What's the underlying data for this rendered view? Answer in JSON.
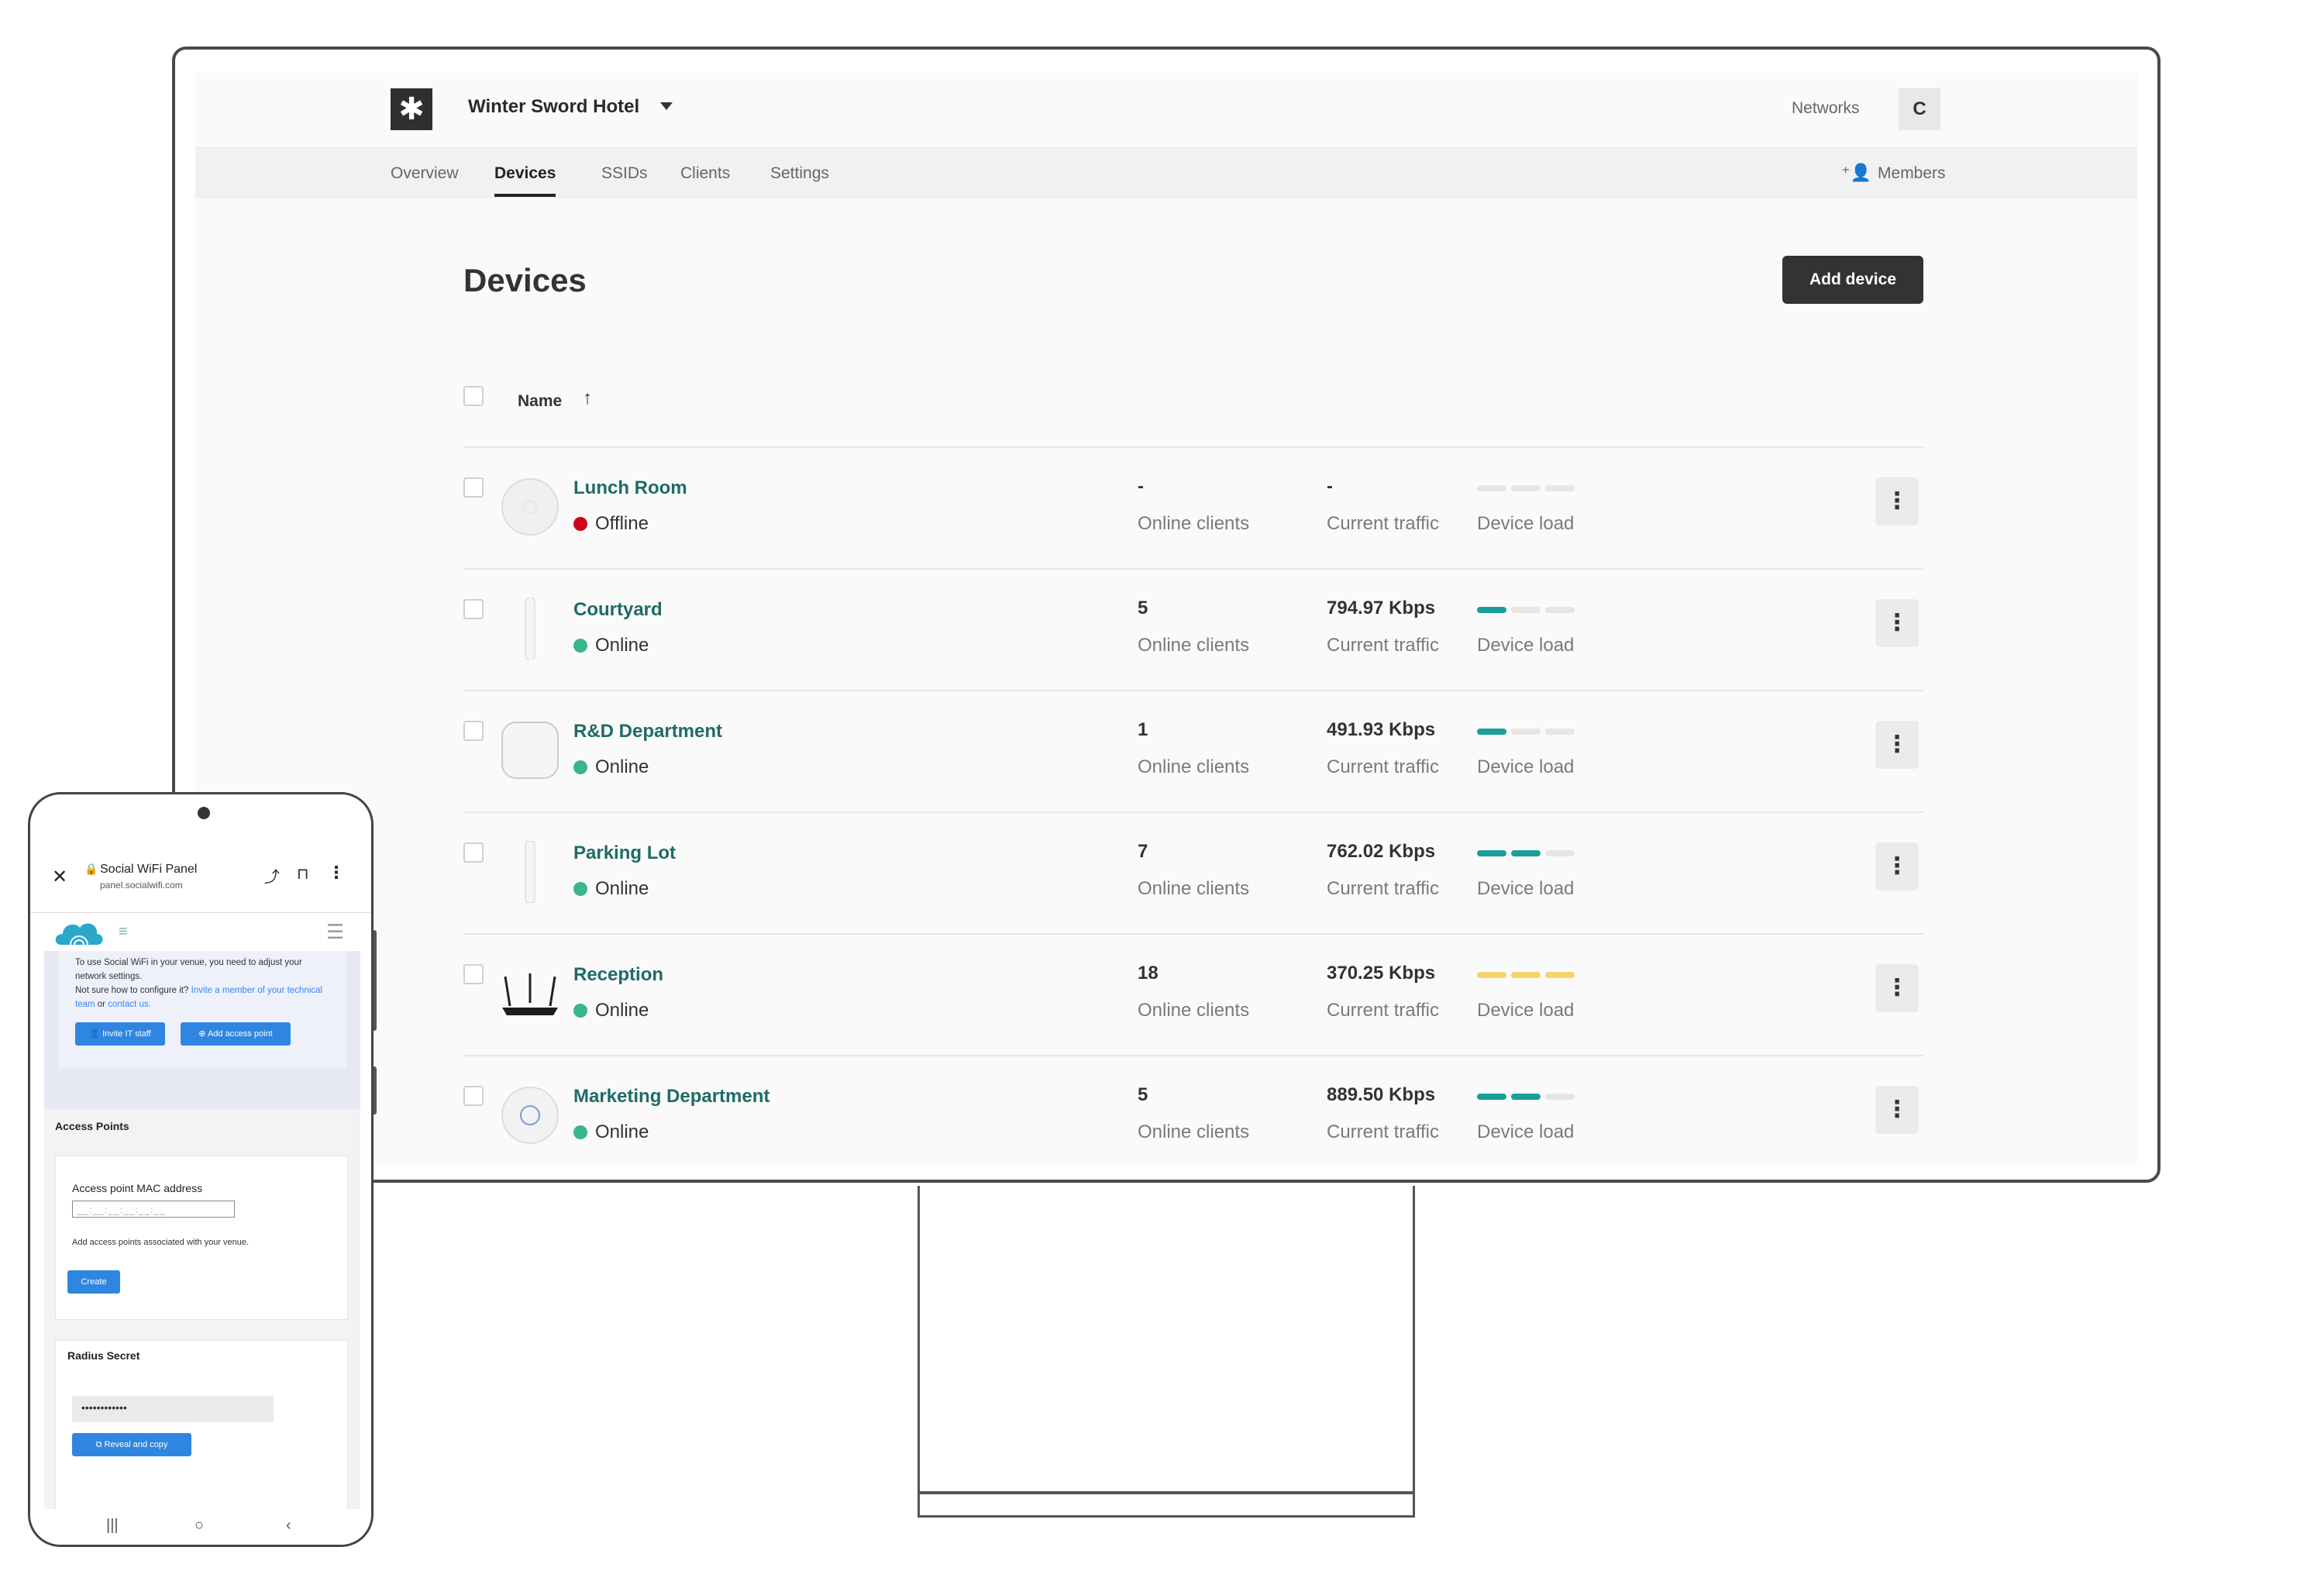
{
  "app": {
    "venue_name": "Winter Sword Hotel",
    "networks_label": "Networks",
    "avatar_initial": "C",
    "members_label": "Members"
  },
  "tabs": [
    "Overview",
    "Devices",
    "SSIDs",
    "Clients",
    "Settings"
  ],
  "active_tab": "Devices",
  "page": {
    "title": "Devices",
    "add_button": "Add device",
    "column_name": "Name",
    "sort_icon": "arrow-up-icon"
  },
  "labels": {
    "online_clients": "Online clients",
    "current_traffic": "Current traffic",
    "device_load": "Device load"
  },
  "devices": [
    {
      "name": "Lunch Room",
      "status": "Offline",
      "status_color": "#d0021b",
      "clients": "-",
      "traffic": "-",
      "load_fraction": 0,
      "load_color": "#e6e6e6",
      "thumb": "ceiling-ap-round"
    },
    {
      "name": "Courtyard",
      "status": "Online",
      "status_color": "#3bb58a",
      "clients": "5",
      "traffic": "794.97 Kbps",
      "load_fraction": 0.33,
      "load_color": "#1a9e9a",
      "thumb": "outdoor-ap-pole"
    },
    {
      "name": "R&D Department",
      "status": "Online",
      "status_color": "#3bb58a",
      "clients": "1",
      "traffic": "491.93 Kbps",
      "load_fraction": 0.33,
      "load_color": "#1a9e9a",
      "thumb": "ceiling-ap-square"
    },
    {
      "name": "Parking Lot",
      "status": "Online",
      "status_color": "#3bb58a",
      "clients": "7",
      "traffic": "762.02 Kbps",
      "load_fraction": 0.67,
      "load_color": "#1a9e9a",
      "thumb": "outdoor-ap-pole"
    },
    {
      "name": "Reception",
      "status": "Online",
      "status_color": "#3bb58a",
      "clients": "18",
      "traffic": "370.25 Kbps",
      "load_fraction": 1.0,
      "load_color": "#f5d36b",
      "thumb": "router-antennas"
    },
    {
      "name": "Marketing Department",
      "status": "Online",
      "status_color": "#3bb58a",
      "clients": "5",
      "traffic": "889.50 Kbps",
      "load_fraction": 0.67,
      "load_color": "#1a9e9a",
      "thumb": "ceiling-ap-round-blue"
    }
  ],
  "phone": {
    "browser_title": "Social WiFi Panel",
    "browser_url": "panel.socialwifi.com",
    "notice_text_1": "To use Social WiFi in your venue, you need to adjust your network settings.",
    "notice_text_2": "Not sure how to configure it?",
    "notice_link_1": "Invite a member of your technical team",
    "notice_or": "or",
    "notice_link_2": "contact us.",
    "invite_button": "Invite IT staff",
    "add_ap_button": "Add access point",
    "access_points_heading": "Access Points",
    "mac_label": "Access point MAC address",
    "mac_placeholder": "__:__:__:__:__:__",
    "mac_help": "Add access points associated with your venue.",
    "create_button": "Create",
    "radius_heading": "Radius Secret",
    "secret_value": "••••••••••••",
    "reveal_button": "Reveal and copy"
  }
}
